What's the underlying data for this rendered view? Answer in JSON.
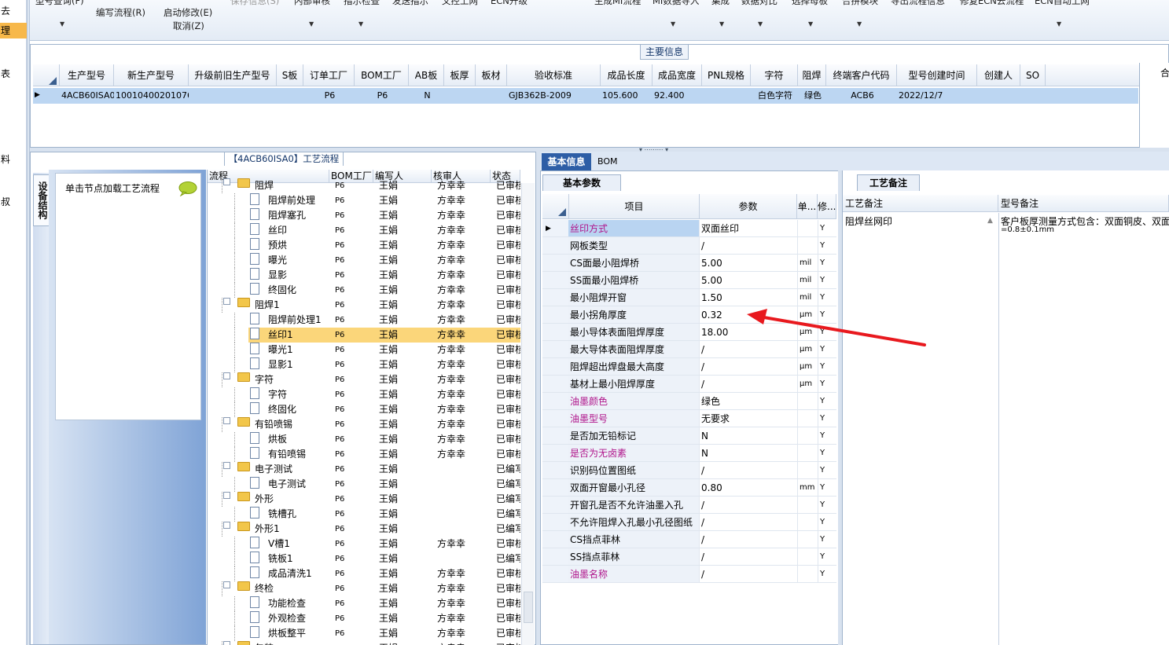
{
  "sidebar": {
    "items": [
      {
        "label": "去",
        "active": false
      },
      {
        "label": "理",
        "active": true
      },
      {
        "label": "表",
        "active": false
      },
      {
        "label": "料",
        "active": false
      },
      {
        "label": "叔",
        "active": false
      }
    ]
  },
  "toolbar": {
    "buttons": [
      {
        "label": "型号查询(F)",
        "enabled": true
      },
      {
        "label": "编写流程(R)",
        "enabled": true
      },
      {
        "label": "启动修改(E)",
        "enabled": true
      },
      {
        "label": "取消(Z)",
        "enabled": true
      },
      {
        "label": "保存信息(S)",
        "enabled": false
      },
      {
        "label": "内部审核",
        "enabled": true
      },
      {
        "label": "指示检查",
        "enabled": true
      },
      {
        "label": "发送指示",
        "enabled": true
      },
      {
        "label": "文控上网",
        "enabled": true
      },
      {
        "label": "ECN升级",
        "enabled": true
      },
      {
        "label": "生成MI流程",
        "enabled": true
      },
      {
        "label": "MI数据导入",
        "enabled": true
      },
      {
        "label": "集成",
        "enabled": true
      },
      {
        "label": "数据对比",
        "enabled": true
      },
      {
        "label": "选择母板",
        "enabled": true
      },
      {
        "label": "合拼模块",
        "enabled": true
      },
      {
        "label": "导出流程信息",
        "enabled": true
      },
      {
        "label": "修复ECN去流程",
        "enabled": true
      },
      {
        "label": "ECN自动上网",
        "enabled": true
      }
    ]
  },
  "main_info": {
    "title": "主要信息",
    "columns": [
      "生产型号",
      "新生产型号",
      "升级前旧生产型号",
      "S板",
      "订单工厂",
      "BOM工厂",
      "AB板",
      "板厚",
      "板材",
      "验收标准",
      "成品长度",
      "成品宽度",
      "PNL规格",
      "字符",
      "阻焊",
      "终端客户代码",
      "型号创建时间",
      "创建人",
      "SO"
    ],
    "right_col_partial": "合",
    "row": [
      "4ACB60ISA0",
      "10010400201076",
      "",
      "",
      "P6",
      "P6",
      "N",
      "",
      "",
      "GJB362B-2009",
      "105.600",
      "92.400",
      "",
      "白色字符",
      "绿色",
      "ACB6",
      "2022/12/7",
      "",
      ""
    ]
  },
  "process_pane": {
    "title": "【4ACB60ISA0】工艺流程",
    "side_tab": "设备结构",
    "hint": "单击节点加载工艺流程",
    "tree_columns": [
      "流程",
      "BOM工厂",
      "编写人",
      "核审人",
      "状态"
    ],
    "rows": [
      {
        "label": "阻焊",
        "type": "folder",
        "level": 1,
        "bom": "P6",
        "writer": "王娟",
        "reviewer": "方幸幸",
        "status": "已审核"
      },
      {
        "label": "阻焊前处理",
        "type": "doc",
        "level": 2,
        "bom": "P6",
        "writer": "王娟",
        "reviewer": "方幸幸",
        "status": "已审核"
      },
      {
        "label": "阻焊塞孔",
        "type": "doc",
        "level": 2,
        "bom": "P6",
        "writer": "王娟",
        "reviewer": "方幸幸",
        "status": "已审核"
      },
      {
        "label": "丝印",
        "type": "doc",
        "level": 2,
        "bom": "P6",
        "writer": "王娟",
        "reviewer": "方幸幸",
        "status": "已审核"
      },
      {
        "label": "预烘",
        "type": "doc",
        "level": 2,
        "bom": "P6",
        "writer": "王娟",
        "reviewer": "方幸幸",
        "status": "已审核"
      },
      {
        "label": "曝光",
        "type": "doc",
        "level": 2,
        "bom": "P6",
        "writer": "王娟",
        "reviewer": "方幸幸",
        "status": "已审核"
      },
      {
        "label": "显影",
        "type": "doc",
        "level": 2,
        "bom": "P6",
        "writer": "王娟",
        "reviewer": "方幸幸",
        "status": "已审核"
      },
      {
        "label": "终固化",
        "type": "doc",
        "level": 2,
        "bom": "P6",
        "writer": "王娟",
        "reviewer": "方幸幸",
        "status": "已审核"
      },
      {
        "label": "阻焊1",
        "type": "folder",
        "level": 1,
        "bom": "P6",
        "writer": "王娟",
        "reviewer": "方幸幸",
        "status": "已审核"
      },
      {
        "label": "阻焊前处理1",
        "type": "doc",
        "level": 2,
        "bom": "P6",
        "writer": "王娟",
        "reviewer": "方幸幸",
        "status": "已审核"
      },
      {
        "label": "丝印1",
        "type": "doc",
        "level": 2,
        "bom": "P6",
        "writer": "王娟",
        "reviewer": "方幸幸",
        "status": "已审核",
        "selected": true
      },
      {
        "label": "曝光1",
        "type": "doc",
        "level": 2,
        "bom": "P6",
        "writer": "王娟",
        "reviewer": "方幸幸",
        "status": "已审核"
      },
      {
        "label": "显影1",
        "type": "doc",
        "level": 2,
        "bom": "P6",
        "writer": "王娟",
        "reviewer": "方幸幸",
        "status": "已审核"
      },
      {
        "label": "字符",
        "type": "folder",
        "level": 1,
        "bom": "P6",
        "writer": "王娟",
        "reviewer": "方幸幸",
        "status": "已审核"
      },
      {
        "label": "字符",
        "type": "doc",
        "level": 2,
        "bom": "P6",
        "writer": "王娟",
        "reviewer": "方幸幸",
        "status": "已审核"
      },
      {
        "label": "终固化",
        "type": "doc",
        "level": 2,
        "bom": "P6",
        "writer": "王娟",
        "reviewer": "方幸幸",
        "status": "已审核"
      },
      {
        "label": "有铅喷锡",
        "type": "folder",
        "level": 1,
        "bom": "P6",
        "writer": "王娟",
        "reviewer": "方幸幸",
        "status": "已审核"
      },
      {
        "label": "烘板",
        "type": "doc",
        "level": 2,
        "bom": "P6",
        "writer": "王娟",
        "reviewer": "方幸幸",
        "status": "已审核"
      },
      {
        "label": "有铅喷锡",
        "type": "doc",
        "level": 2,
        "bom": "P6",
        "writer": "王娟",
        "reviewer": "方幸幸",
        "status": "已审核"
      },
      {
        "label": "电子测试",
        "type": "folder",
        "level": 1,
        "bom": "P6",
        "writer": "王娟",
        "reviewer": "",
        "status": "已编写"
      },
      {
        "label": "电子测试",
        "type": "doc",
        "level": 2,
        "bom": "P6",
        "writer": "王娟",
        "reviewer": "",
        "status": "已编写"
      },
      {
        "label": "外形",
        "type": "folder",
        "level": 1,
        "bom": "P6",
        "writer": "王娟",
        "reviewer": "",
        "status": "已编写"
      },
      {
        "label": "铣槽孔",
        "type": "doc",
        "level": 2,
        "bom": "P6",
        "writer": "王娟",
        "reviewer": "",
        "status": "已编写"
      },
      {
        "label": "外形1",
        "type": "folder",
        "level": 1,
        "bom": "P6",
        "writer": "王娟",
        "reviewer": "",
        "status": "已编写"
      },
      {
        "label": "V槽1",
        "type": "doc",
        "level": 2,
        "bom": "P6",
        "writer": "王娟",
        "reviewer": "方幸幸",
        "status": "已审核"
      },
      {
        "label": "铣板1",
        "type": "doc",
        "level": 2,
        "bom": "P6",
        "writer": "王娟",
        "reviewer": "",
        "status": "已编写"
      },
      {
        "label": "成品清洗1",
        "type": "doc",
        "level": 2,
        "bom": "P6",
        "writer": "王娟",
        "reviewer": "方幸幸",
        "status": "已审核"
      },
      {
        "label": "终检",
        "type": "folder",
        "level": 1,
        "bom": "P6",
        "writer": "王娟",
        "reviewer": "方幸幸",
        "status": "已审核"
      },
      {
        "label": "功能检查",
        "type": "doc",
        "level": 2,
        "bom": "P6",
        "writer": "王娟",
        "reviewer": "方幸幸",
        "status": "已审核"
      },
      {
        "label": "外观检查",
        "type": "doc",
        "level": 2,
        "bom": "P6",
        "writer": "王娟",
        "reviewer": "方幸幸",
        "status": "已审核"
      },
      {
        "label": "烘板整平",
        "type": "doc",
        "level": 2,
        "bom": "P6",
        "writer": "王娟",
        "reviewer": "方幸幸",
        "status": "已审核"
      },
      {
        "label": "包装",
        "type": "folder",
        "level": 1,
        "bom": "P6",
        "writer": "王娟",
        "reviewer": "方幸幸",
        "status": "已审核"
      }
    ]
  },
  "detail_tabs": {
    "basic": "基本信息",
    "bom": "BOM"
  },
  "basic_params": {
    "title": "基本参数",
    "columns": [
      "项目",
      "参数",
      "单...",
      "修..."
    ],
    "rows": [
      {
        "item": "丝印方式",
        "param": "双面丝印",
        "unit": "",
        "mod": "Y",
        "highlight": true
      },
      {
        "item": "网板类型",
        "param": "/",
        "unit": "",
        "mod": "Y",
        "highlight": false
      },
      {
        "item": "CS面最小阻焊桥",
        "param": "5.00",
        "unit": "mil",
        "mod": "Y",
        "highlight": false
      },
      {
        "item": "SS面最小阻焊桥",
        "param": "5.00",
        "unit": "mil",
        "mod": "Y",
        "highlight": false
      },
      {
        "item": "最小阻焊开窗",
        "param": "1.50",
        "unit": "mil",
        "mod": "Y",
        "highlight": false
      },
      {
        "item": "最小拐角厚度",
        "param": "0.32",
        "unit": "μm",
        "mod": "Y",
        "highlight": false
      },
      {
        "item": "最小导体表面阻焊厚度",
        "param": "18.00",
        "unit": "μm",
        "mod": "Y",
        "highlight": false
      },
      {
        "item": "最大导体表面阻焊厚度",
        "param": "/",
        "unit": "μm",
        "mod": "Y",
        "highlight": false
      },
      {
        "item": "阻焊超出焊盘最大高度",
        "param": "/",
        "unit": "μm",
        "mod": "Y",
        "highlight": false
      },
      {
        "item": "基材上最小阻焊厚度",
        "param": "/",
        "unit": "μm",
        "mod": "Y",
        "highlight": false
      },
      {
        "item": "油墨颜色",
        "param": "绿色",
        "unit": "",
        "mod": "Y",
        "highlight": true
      },
      {
        "item": "油墨型号",
        "param": "无要求",
        "unit": "",
        "mod": "Y",
        "highlight": true
      },
      {
        "item": "是否加无铅标记",
        "param": "N",
        "unit": "",
        "mod": "Y",
        "highlight": false
      },
      {
        "item": "是否为无卤素",
        "param": "N",
        "unit": "",
        "mod": "Y",
        "highlight": true
      },
      {
        "item": "识别码位置图纸",
        "param": "/",
        "unit": "",
        "mod": "Y",
        "highlight": false
      },
      {
        "item": "双面开窗最小孔径",
        "param": "0.80",
        "unit": "mm",
        "mod": "Y",
        "highlight": false
      },
      {
        "item": "开窗孔是否不允许油墨入孔",
        "param": "/",
        "unit": "",
        "mod": "Y",
        "highlight": false
      },
      {
        "item": "不允许阻焊入孔最小孔径图纸",
        "param": "/",
        "unit": "",
        "mod": "Y",
        "highlight": false
      },
      {
        "item": "CS挡点菲林",
        "param": "/",
        "unit": "",
        "mod": "Y",
        "highlight": false
      },
      {
        "item": "SS挡点菲林",
        "param": "/",
        "unit": "",
        "mod": "Y",
        "highlight": false
      },
      {
        "item": "油墨名称",
        "param": "/",
        "unit": "",
        "mod": "Y",
        "highlight": true
      }
    ]
  },
  "process_note": {
    "title": "工艺备注",
    "columns": [
      "工艺备注",
      "型号备注"
    ],
    "row": {
      "note": "阻焊丝网印",
      "model_note": "客户板厚测量方式包含：双面铜皮、双面",
      "model_note_2": "=0.8±0.1mm"
    }
  },
  "colors": {
    "selection": "#bcd6f2",
    "tree_selected": "#fbd67a",
    "tab_active": "#2e5ea6",
    "magenta_text": "#b0148b",
    "annotation_arrow": "#e8191e"
  }
}
